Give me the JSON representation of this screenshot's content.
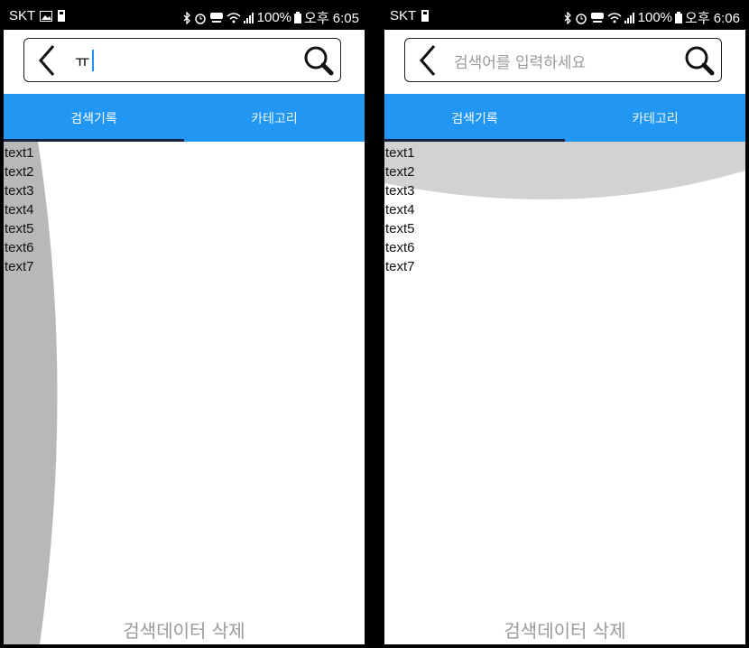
{
  "screens": [
    {
      "status": {
        "carrier": "SKT",
        "battery": "100%",
        "time": "오후 6:05"
      },
      "search": {
        "value": "ㅠ",
        "placeholder": ""
      },
      "tabs": [
        {
          "label": "검색기록"
        },
        {
          "label": "카테고리"
        }
      ],
      "items": [
        "text1",
        "text2",
        "text3",
        "text4",
        "text5",
        "text6",
        "text7"
      ],
      "footer": {
        "label": "검색데이터 삭제"
      }
    },
    {
      "status": {
        "carrier": "SKT",
        "battery": "100%",
        "time": "오후 6:06"
      },
      "search": {
        "value": "",
        "placeholder": "검색어를 입력하세요"
      },
      "tabs": [
        {
          "label": "검색기록"
        },
        {
          "label": "카테고리"
        }
      ],
      "items": [
        "text1",
        "text2",
        "text3",
        "text4",
        "text5",
        "text6",
        "text7"
      ],
      "footer": {
        "label": "검색데이터 삭제"
      }
    }
  ],
  "colors": {
    "tab_bar": "#2196f3",
    "tab_indicator": "#1a2340",
    "overlay": "#c8c8c8",
    "caret": "#1e90ff"
  }
}
